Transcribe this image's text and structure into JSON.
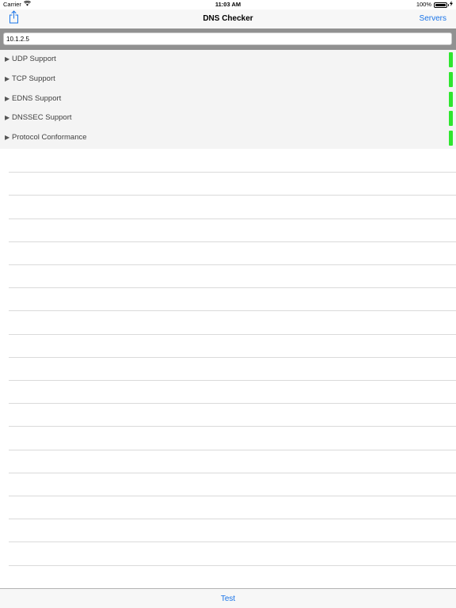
{
  "status_bar": {
    "carrier": "Carrier",
    "time": "11:03 AM",
    "battery_text": "100%",
    "battery_level": 1.0,
    "wifi_icon": "wifi-icon",
    "charging_icon": "bolt-icon"
  },
  "nav": {
    "title": "DNS Checker",
    "left_icon": "share-icon",
    "right_button": "Servers"
  },
  "search": {
    "value": "10.1.2.5"
  },
  "sections": [
    {
      "label": "UDP Support",
      "status_color": "#2ee62e"
    },
    {
      "label": "TCP Support",
      "status_color": "#2ee62e"
    },
    {
      "label": "EDNS Support",
      "status_color": "#2ee62e"
    },
    {
      "label": "DNSSEC Support",
      "status_color": "#2ee62e"
    },
    {
      "label": "Protocol Conformance",
      "status_color": "#2ee62e"
    }
  ],
  "toolbar": {
    "test_label": "Test"
  },
  "colors": {
    "accent": "#1a74e8",
    "ok": "#2ee62e"
  }
}
